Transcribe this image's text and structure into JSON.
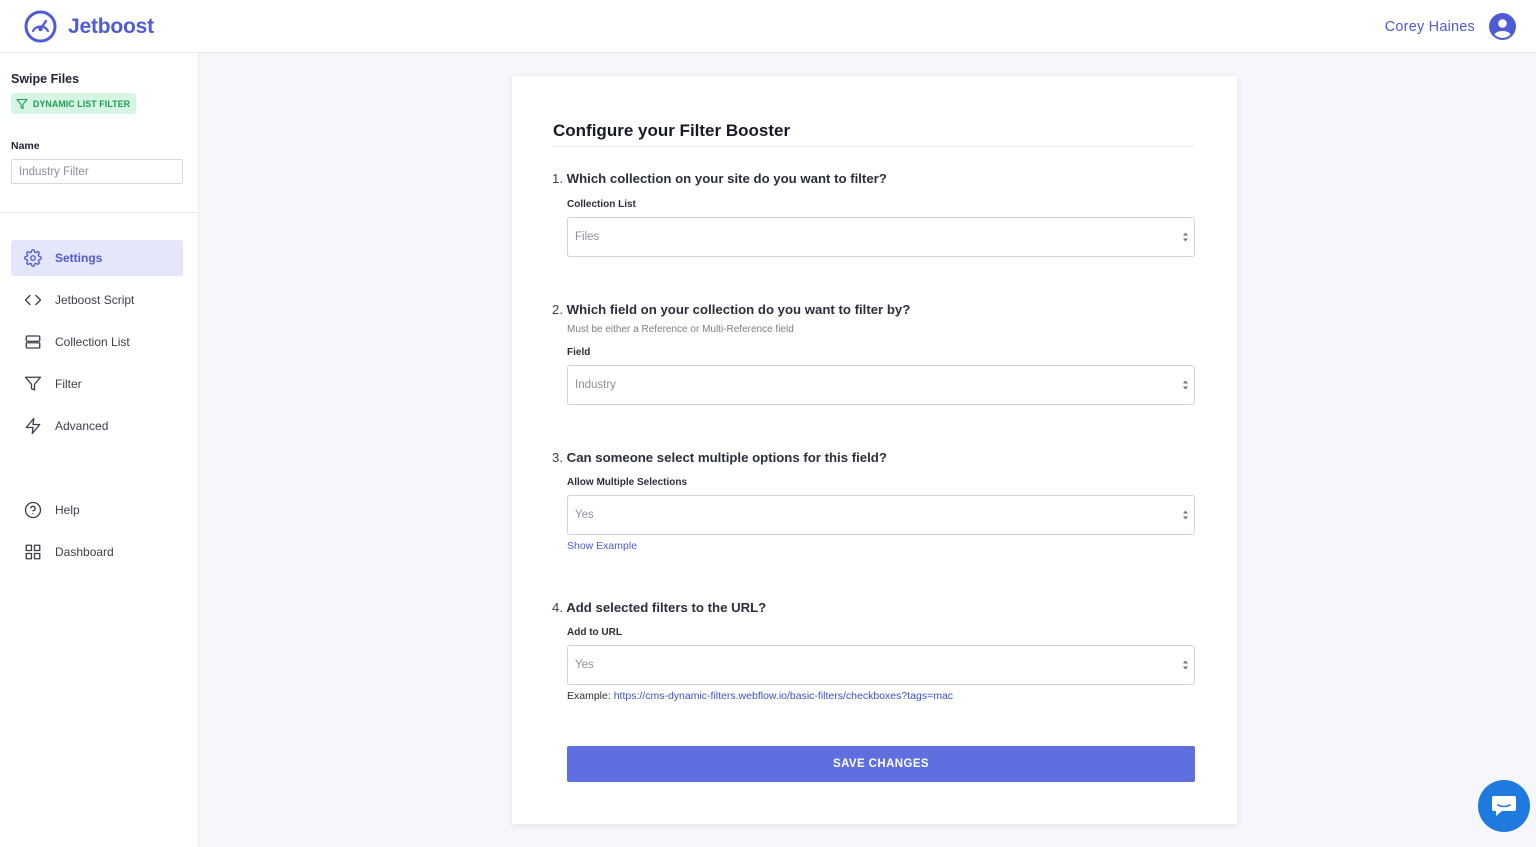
{
  "app": {
    "brand": "Jetboost",
    "brand_color": "#4f5bd5",
    "user_name": "Corey Haines"
  },
  "sidebar": {
    "site_title": "Swipe Files",
    "booster_type": "DYNAMIC LIST FILTER",
    "name_label": "Name",
    "name_placeholder": "Industry Filter",
    "nav": [
      {
        "label": "Settings",
        "icon": "gear-icon",
        "active": true
      },
      {
        "label": "Jetboost Script",
        "icon": "code-icon",
        "active": false
      },
      {
        "label": "Collection List",
        "icon": "list-icon",
        "active": false
      },
      {
        "label": "Filter",
        "icon": "filter-icon",
        "active": false
      },
      {
        "label": "Advanced",
        "icon": "bolt-icon",
        "active": false
      }
    ],
    "nav_bottom": [
      {
        "label": "Help",
        "icon": "help-icon"
      },
      {
        "label": "Dashboard",
        "icon": "grid-icon"
      }
    ]
  },
  "form": {
    "title": "Configure your Filter Booster",
    "q1": {
      "num": "1.",
      "text": "Which collection on your site do you want to filter?",
      "label": "Collection List",
      "value": "Files"
    },
    "q2": {
      "num": "2.",
      "text": "Which field on your collection do you want to filter by?",
      "hint": "Must be either a Reference or Multi-Reference field",
      "label": "Field",
      "value": "Industry"
    },
    "q3": {
      "num": "3.",
      "text": "Can someone select multiple options for this field?",
      "label": "Allow Multiple Selections",
      "value": "Yes",
      "link": "Show Example"
    },
    "q4": {
      "num": "4.",
      "text": "Add selected filters to the URL?",
      "label": "Add to URL",
      "value": "Yes",
      "example_prefix": "Example:",
      "example_url": "https://cms-dynamic-filters.webflow.io/basic-filters/checkboxes?tags=mac"
    },
    "save_label": "SAVE CHANGES"
  }
}
